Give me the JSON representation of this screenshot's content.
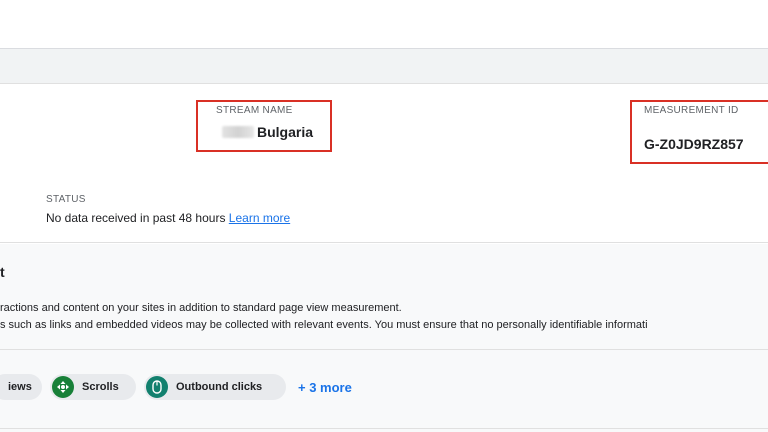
{
  "stream": {
    "name_label": "STREAM NAME",
    "name_value": "Bulgaria",
    "measurement_label": "MEASUREMENT ID",
    "measurement_value": "G-Z0JD9RZ857",
    "status_label": "STATUS",
    "status_text": "No data received in past 48 hours",
    "learn_more": "Learn more"
  },
  "enhanced": {
    "title_fragment": "t",
    "line1": "ractions and content on your sites in addition to standard page view measurement.",
    "line2": "s such as links and embedded videos may be collected with relevant events. You must ensure that no personally identifiable informati"
  },
  "chips": {
    "items": [
      {
        "label": "iews",
        "icon": "eye-icon"
      },
      {
        "label": "Scrolls",
        "icon": "scroll-icon"
      },
      {
        "label": "Outbound clicks",
        "icon": "mouse-icon"
      }
    ],
    "more": "+ 3 more"
  },
  "colors": {
    "highlight": "#d93025",
    "link": "#1a73e8",
    "scroll_icon": "#188038",
    "click_icon": "#12806e"
  }
}
